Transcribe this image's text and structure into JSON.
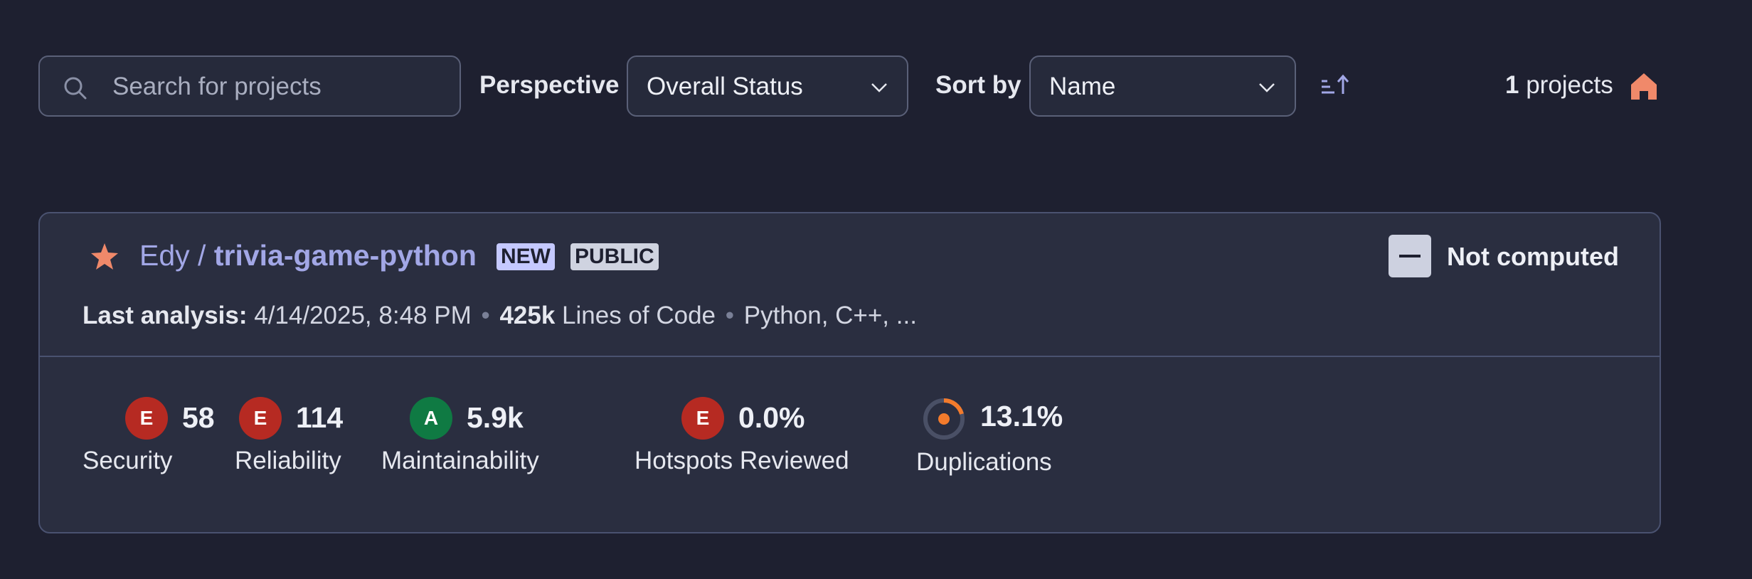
{
  "toolbar": {
    "search_placeholder": "Search for projects",
    "perspective_label": "Perspective",
    "perspective_value": "Overall Status",
    "sort_label": "Sort by",
    "sort_value": "Name",
    "project_count": "1",
    "project_count_suffix": " projects"
  },
  "project": {
    "owner": "Edy",
    "separator": " / ",
    "name": "trivia-game-python",
    "badge_new": "NEW",
    "badge_public": "PUBLIC",
    "quality_gate": "Not computed",
    "last_analysis_label": "Last analysis:",
    "last_analysis_value": " 4/14/2025, 8:48 PM",
    "loc_value": "425k",
    "loc_label": " Lines of Code",
    "languages": "Python, C++, ...",
    "metrics": [
      {
        "rating": "E",
        "value": "58",
        "label": "Security"
      },
      {
        "rating": "E",
        "value": "114",
        "label": "Reliability"
      },
      {
        "rating": "A",
        "value": "5.9k",
        "label": "Maintainability"
      },
      {
        "rating": "E",
        "value": "0.0%",
        "label": "Hotspots Reviewed"
      },
      {
        "value": "13.1%",
        "label": "Duplications"
      }
    ]
  },
  "colors": {
    "background": "#1e2030",
    "card": "#2a2e40",
    "accent": "#a2a7e6",
    "rating_e": "#b62a22",
    "rating_a": "#0f7a43",
    "star": "#f0896a",
    "duplication_ring": "#f37b2c"
  },
  "icons": [
    "search-icon",
    "chevron-down-icon",
    "sort-ascending-icon",
    "home-icon",
    "star-icon",
    "duplication-ring-icon"
  ]
}
